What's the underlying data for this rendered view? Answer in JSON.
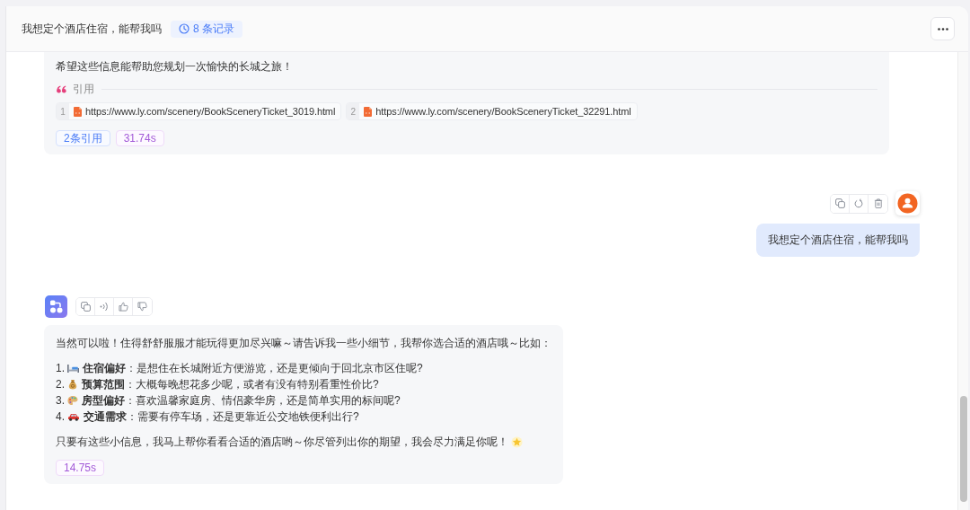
{
  "header": {
    "title": "我想定个酒店住宿，能帮我吗",
    "history_badge": "8 条记录"
  },
  "messages": [
    {
      "kind": "assistant",
      "cut_off_top": true,
      "blocks": [
        {
          "kind": "paragraph",
          "text": "希望这些信息能帮助您规划一次愉快的长城之旅！",
          "trailing_emoji": false
        },
        {
          "kind": "references",
          "label": "引用",
          "items": [
            {
              "number": "1",
              "url": "https://www.ly.com/scenery/BookSceneryTicket_3019.html"
            },
            {
              "number": "2",
              "url": "https://www.ly.com/scenery/BookSceneryTicket_32291.html"
            }
          ]
        }
      ],
      "tags": [
        {
          "kind": "count",
          "text": "2条引用"
        },
        {
          "kind": "duration",
          "text": "31.74s"
        }
      ]
    },
    {
      "kind": "user",
      "text": "我想定个酒店住宿，能帮我吗"
    },
    {
      "kind": "assistant",
      "cut_off_top": false,
      "blocks": [
        {
          "kind": "paragraph",
          "text": "当然可以啦！住得舒舒服服才能玩得更加尽兴嘛～请告诉我一些小细节，我帮你选合适的酒店哦～比如：",
          "trailing_emoji": false
        },
        {
          "kind": "list",
          "items": [
            {
              "number": "1.",
              "text": "**住宿偏好**：是想住在长城附近方便游览，还是更倾向于回北京市区住呢?"
            },
            {
              "number": "2.",
              "text": "**预算范围**：大概每晚想花多少呢，或者有没有特别看重性价比?"
            },
            {
              "number": "3.",
              "text": "**房型偏好**：喜欢温馨家庭房、情侣豪华房，还是简单实用的标间呢?"
            },
            {
              "number": "4.",
              "text": "**交通需求**：需要有停车场，还是更靠近公交地铁便利出行?"
            }
          ]
        },
        {
          "kind": "paragraph",
          "text": "只要有这些小信息，我马上帮你看看合适的酒店哟～你尽管列出你的期望，我会尽力满足你呢！",
          "trailing_emoji": true
        }
      ],
      "tags": [
        {
          "kind": "duration",
          "text": "14.75s"
        }
      ]
    }
  ]
}
